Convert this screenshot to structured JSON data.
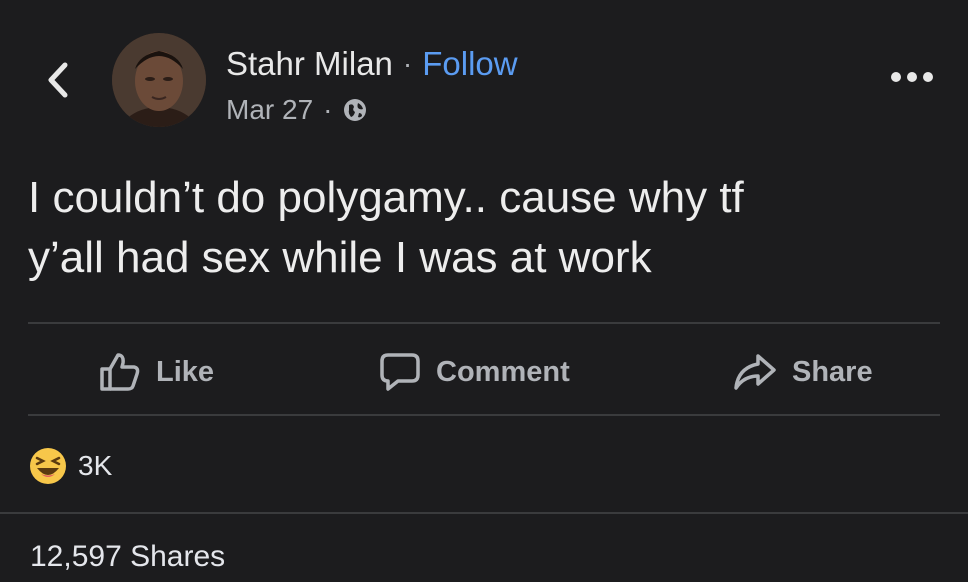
{
  "author": {
    "name": "Stahr Milan",
    "separator": "·",
    "follow_label": "Follow",
    "date": "Mar 27",
    "date_separator": "·",
    "privacy_icon": "globe-icon"
  },
  "post": {
    "line1": "I couldn’t do polygamy.. cause why tf",
    "line2": "y’all had sex while I was at work"
  },
  "actions": {
    "like_label": "Like",
    "comment_label": "Comment",
    "share_label": "Share"
  },
  "reactions": {
    "icon": "laughing-emoji-icon",
    "count": "3K"
  },
  "shares_text": "12,597 Shares",
  "colors": {
    "background": "#1c1c1e",
    "link": "#5b9cf2",
    "muted": "#b0b3b8",
    "text": "#e4e6eb"
  }
}
